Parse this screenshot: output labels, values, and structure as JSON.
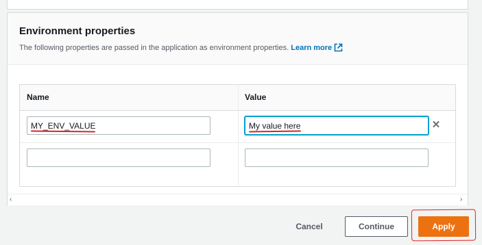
{
  "section": {
    "title": "Environment properties",
    "description": "The following properties are passed in the application as environment properties.",
    "learn_more": "Learn more",
    "learn_more_icon": "external-link-icon"
  },
  "table": {
    "columns": [
      "Name",
      "Value"
    ],
    "rows": [
      {
        "name": "MY_ENV_VALUE",
        "value": "My value here"
      },
      {
        "name": "",
        "value": ""
      }
    ],
    "remove_icon": "close-icon"
  },
  "scrollbar": {
    "left_arrow": "‹",
    "right_arrow": "›"
  },
  "actions": {
    "cancel": "Cancel",
    "continue": "Continue",
    "apply": "Apply"
  },
  "colors": {
    "primary": "#ec7211",
    "link": "#0073bb",
    "annotation": "#e02020"
  }
}
